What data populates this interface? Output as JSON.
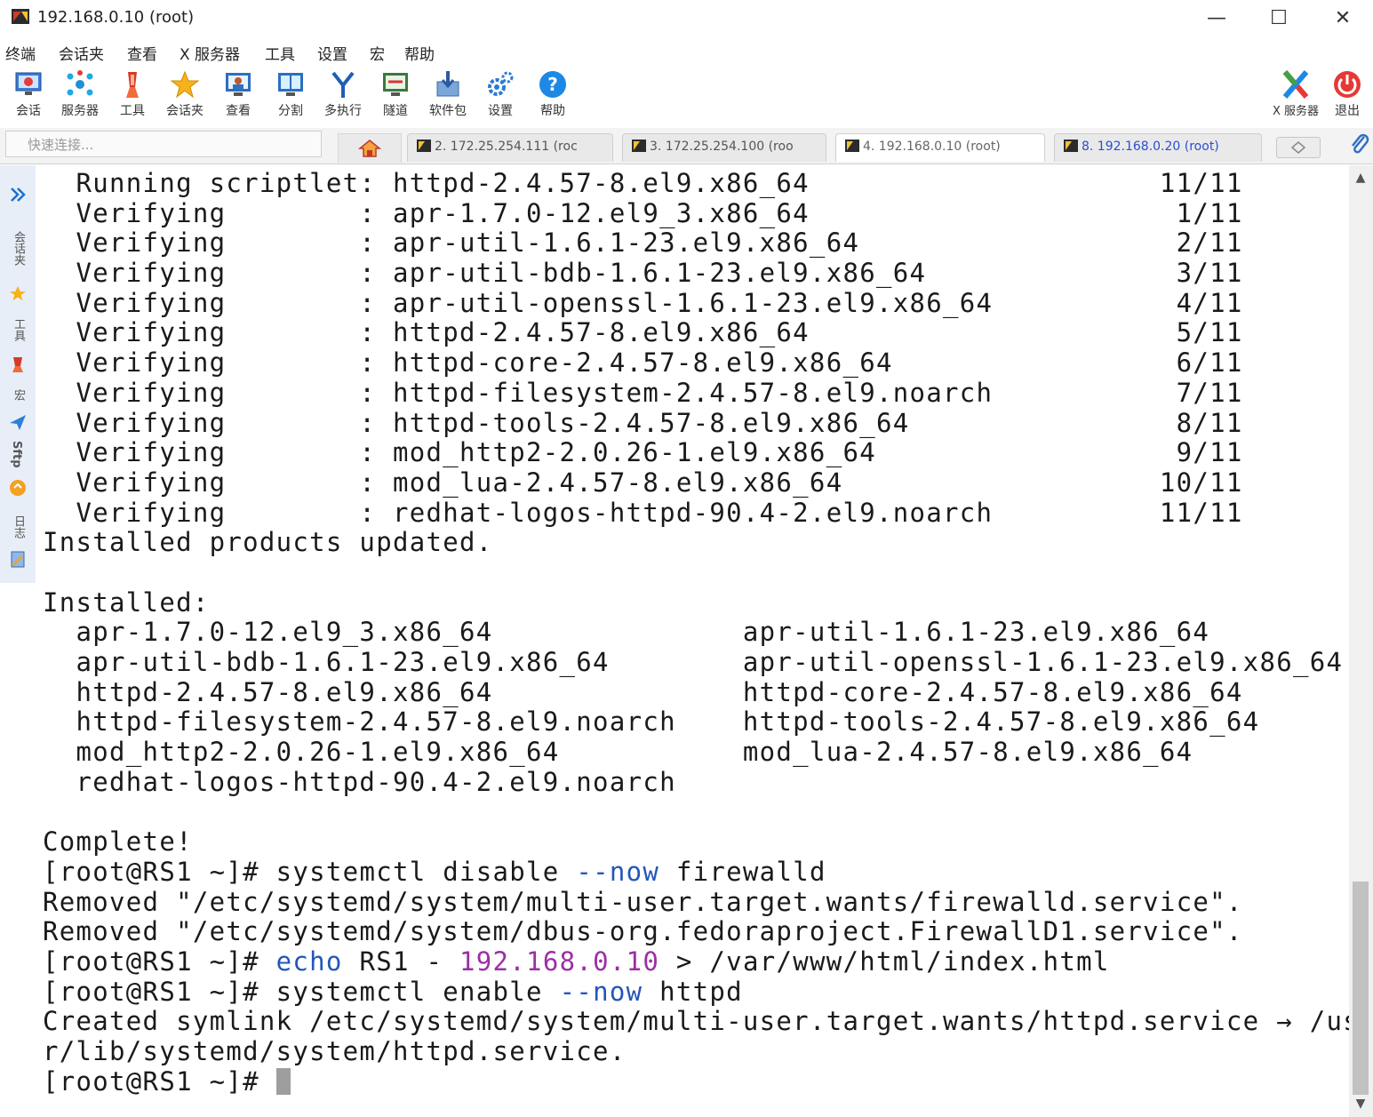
{
  "window": {
    "title": "192.168.0.10 (root)"
  },
  "menu": [
    "终端",
    "会话夹",
    "查看",
    "X 服务器",
    "工具",
    "设置",
    "宏",
    "帮助"
  ],
  "toolbar": {
    "items": [
      {
        "label": "会话",
        "icon": "session-icon"
      },
      {
        "label": "服务器",
        "icon": "servers-icon"
      },
      {
        "label": "工具",
        "icon": "tools-icon"
      },
      {
        "label": "会话夹",
        "icon": "star-icon"
      },
      {
        "label": "查看",
        "icon": "view-icon"
      },
      {
        "label": "分割",
        "icon": "split-icon"
      },
      {
        "label": "多执行",
        "icon": "multiexec-icon"
      },
      {
        "label": "隧道",
        "icon": "tunnel-icon"
      },
      {
        "label": "软件包",
        "icon": "packages-icon"
      },
      {
        "label": "设置",
        "icon": "settings-icon"
      },
      {
        "label": "帮助",
        "icon": "help-icon"
      }
    ],
    "xserver_label": "X 服务器",
    "exit_label": "退出"
  },
  "quick_connect": {
    "placeholder": "快速连接..."
  },
  "tabs": [
    {
      "label": "2. 172.25.254.111 (roc",
      "active": false
    },
    {
      "label": "3. 172.25.254.100 (roo",
      "active": false
    },
    {
      "label": "4. 192.168.0.10 (root)",
      "active": true
    },
    {
      "label": "8. 192.168.0.20 (root)",
      "active": false
    }
  ],
  "sidebar": {
    "labels": [
      "会话夹",
      "工具",
      "宏",
      "Sftp",
      "日志"
    ]
  },
  "terminal": {
    "lines": [
      "  Running scriptlet: httpd-2.4.57-8.el9.x86_64                     11/11",
      "  Verifying        : apr-1.7.0-12.el9_3.x86_64                      1/11",
      "  Verifying        : apr-util-1.6.1-23.el9.x86_64                   2/11",
      "  Verifying        : apr-util-bdb-1.6.1-23.el9.x86_64               3/11",
      "  Verifying        : apr-util-openssl-1.6.1-23.el9.x86_64           4/11",
      "  Verifying        : httpd-2.4.57-8.el9.x86_64                      5/11",
      "  Verifying        : httpd-core-2.4.57-8.el9.x86_64                 6/11",
      "  Verifying        : httpd-filesystem-2.4.57-8.el9.noarch           7/11",
      "  Verifying        : httpd-tools-2.4.57-8.el9.x86_64                8/11",
      "  Verifying        : mod_http2-2.0.26-1.el9.x86_64                  9/11",
      "  Verifying        : mod_lua-2.4.57-8.el9.x86_64                   10/11",
      "  Verifying        : redhat-logos-httpd-90.4-2.el9.noarch          11/11",
      "Installed products updated.",
      "",
      "Installed:",
      "  apr-1.7.0-12.el9_3.x86_64               apr-util-1.6.1-23.el9.x86_64",
      "  apr-util-bdb-1.6.1-23.el9.x86_64        apr-util-openssl-1.6.1-23.el9.x86_64",
      "  httpd-2.4.57-8.el9.x86_64               httpd-core-2.4.57-8.el9.x86_64",
      "  httpd-filesystem-2.4.57-8.el9.noarch    httpd-tools-2.4.57-8.el9.x86_64",
      "  mod_http2-2.0.26-1.el9.x86_64           mod_lua-2.4.57-8.el9.x86_64",
      "  redhat-logos-httpd-90.4-2.el9.noarch",
      "",
      "Complete!"
    ],
    "commands": [
      {
        "prompt": "[root@RS1 ~]# ",
        "parts": [
          [
            "systemctl disable ",
            ""
          ],
          [
            "--now",
            "kw"
          ],
          [
            " firewalld",
            ""
          ]
        ]
      },
      {
        "output": "Removed \"/etc/systemd/system/multi-user.target.wants/firewalld.service\"."
      },
      {
        "output": "Removed \"/etc/systemd/system/dbus-org.fedoraproject.FirewallD1.service\"."
      },
      {
        "prompt": "[root@RS1 ~]# ",
        "parts": [
          [
            "echo",
            "kw"
          ],
          [
            " RS1 - ",
            ""
          ],
          [
            "192.168.0.10",
            "ip"
          ],
          [
            " > /var/www/html/index.html",
            ""
          ]
        ]
      },
      {
        "prompt": "[root@RS1 ~]# ",
        "parts": [
          [
            "systemctl enable ",
            ""
          ],
          [
            "--now",
            "kw"
          ],
          [
            " httpd",
            ""
          ]
        ]
      },
      {
        "output": "Created symlink /etc/systemd/system/multi-user.target.wants/httpd.service → /us"
      },
      {
        "output": "r/lib/systemd/system/httpd.service."
      },
      {
        "prompt": "[root@RS1 ~]# ",
        "parts": [],
        "cursor": true
      }
    ]
  },
  "colors": {
    "keyword": "#2357b8",
    "ip": "#9b2fa4",
    "sidebar_bg": "#e7eef7"
  }
}
